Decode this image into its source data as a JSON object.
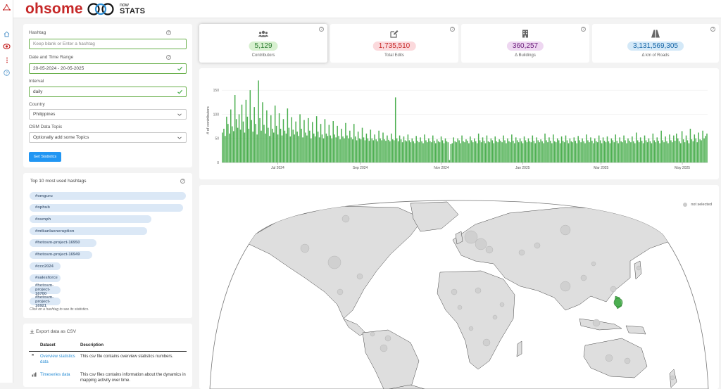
{
  "header": {
    "logo_text": "ohsome",
    "logo_now": "now",
    "logo_stats": "STATS"
  },
  "form": {
    "hashtag_label": "Hashtag",
    "hashtag_placeholder": "Keep blank or Enter a hashtag",
    "date_label": "Date and Time Range",
    "date_value": "20-05-2024 - 20-05-2025",
    "interval_label": "Interval",
    "interval_value": "daily",
    "country_label": "Country",
    "country_value": "Philippines",
    "topic_label": "OSM Data Topic",
    "topic_placeholder": "Optionally add some Topics",
    "submit_label": "Get Statistics"
  },
  "hashtags": {
    "title": "Top 10 most used hashtags",
    "items": [
      {
        "label": "#omguru",
        "share": 1.0
      },
      {
        "label": "#ophub",
        "share": 0.98
      },
      {
        "label": "#osmph",
        "share": 0.78
      },
      {
        "label": "#mtkanlaoneruption",
        "share": 0.75
      },
      {
        "label": "#hotosm-project-16950",
        "share": 0.43
      },
      {
        "label": "#hotosm-project-16949",
        "share": 0.4
      },
      {
        "label": "#ccc2024",
        "share": 0.2
      },
      {
        "label": "#salesforce",
        "share": 0.19
      },
      {
        "label": "#hotosm-project-16700",
        "share": 0.14
      },
      {
        "label": "#hotosm-project-16921",
        "share": 0.1
      }
    ],
    "note": "Click on a hashtag to see its statistics."
  },
  "export": {
    "title": "Export data as CSV",
    "col_dataset": "Dataset",
    "col_description": "Description",
    "rows": [
      {
        "icon": "quote-icon",
        "link": "Overview statistics data",
        "desc": "This csv file contains overview statistics numbers."
      },
      {
        "icon": "bar-chart-icon",
        "link": "Timeseries data",
        "desc": "This csv files contains information about the dynamics in mapping activity over time."
      }
    ]
  },
  "stats": [
    {
      "icon": "users-icon",
      "value": "5,129",
      "label": "Contributors",
      "bg": "#d7f0cf",
      "fg": "#2e7d32"
    },
    {
      "icon": "edit-icon",
      "value": "1,735,510",
      "label": "Total Edits",
      "bg": "#fbd9dc",
      "fg": "#c62828"
    },
    {
      "icon": "building-icon",
      "value": "360,257",
      "label": "Δ Buildings",
      "bg": "#eed7f1",
      "fg": "#6a1b7a"
    },
    {
      "icon": "road-icon",
      "value": "3,131,569,305",
      "label": "Δ km of Roads",
      "bg": "#d4e9f8",
      "fg": "#1565a6"
    }
  ],
  "chart_data": {
    "type": "bar",
    "ylabel": "# of contributors",
    "ylim": [
      0,
      175
    ],
    "yticks": [
      0,
      50,
      100,
      150
    ],
    "x_start": "2024-05-20",
    "x_end": "2025-05-20",
    "xticks": [
      {
        "label": "Jul 2024",
        "date": "2024-07-01"
      },
      {
        "label": "Sep 2024",
        "date": "2024-09-01"
      },
      {
        "label": "Nov 2024",
        "date": "2024-11-01"
      },
      {
        "label": "Jan 2025",
        "date": "2025-01-01"
      },
      {
        "label": "Mar 2025",
        "date": "2025-03-01"
      },
      {
        "label": "May 2025",
        "date": "2025-05-01"
      }
    ],
    "color": "#4caf50",
    "values": [
      62,
      70,
      55,
      95,
      80,
      60,
      110,
      75,
      65,
      140,
      90,
      72,
      100,
      68,
      120,
      85,
      62,
      130,
      95,
      70,
      150,
      88,
      64,
      115,
      80,
      58,
      170,
      92,
      66,
      125,
      78,
      60,
      108,
      72,
      55,
      98,
      70,
      62,
      118,
      76,
      58,
      102,
      70,
      56,
      90,
      66,
      60,
      112,
      72,
      54,
      94,
      68,
      58,
      85,
      64,
      55,
      100,
      70,
      52,
      88,
      62,
      56,
      92,
      66,
      50,
      84,
      60,
      54,
      96,
      64,
      52,
      80,
      58,
      50,
      90,
      60,
      55,
      78,
      56,
      50,
      86,
      58,
      52,
      76,
      55,
      48,
      70,
      54,
      50,
      82,
      56,
      50,
      66,
      52,
      48,
      80,
      54,
      46,
      64,
      50,
      48,
      72,
      52,
      46,
      60,
      50,
      45,
      68,
      50,
      46,
      58,
      48,
      44,
      66,
      50,
      46,
      62,
      48,
      45,
      56,
      47,
      44,
      60,
      48,
      46,
      135,
      50,
      44,
      56,
      48,
      42,
      54,
      46,
      44,
      58,
      46,
      42,
      50,
      44,
      40,
      55,
      45,
      42,
      52,
      44,
      40,
      58,
      46,
      42,
      50,
      44,
      42,
      56,
      45,
      40,
      48,
      44,
      42,
      54,
      46,
      40,
      50,
      44,
      42,
      5,
      38,
      40,
      52,
      44,
      42,
      50,
      46,
      40,
      56,
      44,
      42,
      48,
      45,
      40,
      54,
      46,
      42,
      50,
      44,
      40,
      60,
      46,
      42,
      52,
      45,
      40,
      56,
      44,
      42,
      50,
      46,
      40,
      54,
      44,
      42,
      48,
      45,
      42,
      56,
      46,
      40,
      50,
      44,
      42,
      58,
      45,
      40,
      52,
      46,
      42,
      50,
      44,
      40,
      54,
      46,
      42,
      50,
      44,
      42,
      56,
      45,
      40,
      52,
      46,
      42,
      48,
      44,
      40,
      60,
      46,
      42,
      52,
      45,
      40,
      58,
      44,
      42,
      50,
      46,
      40,
      54,
      45,
      42,
      56,
      46,
      40,
      50,
      44,
      42,
      52,
      45,
      40,
      55,
      46,
      42,
      50,
      44,
      40,
      58,
      46,
      42,
      52,
      45,
      40,
      50,
      44,
      42,
      56,
      46,
      40,
      52,
      45,
      42,
      54,
      44,
      40,
      50,
      46,
      42,
      58,
      45,
      40,
      52,
      44,
      42,
      56,
      46,
      40,
      50,
      45,
      42,
      54,
      44,
      40,
      62,
      46,
      42,
      52,
      45,
      40,
      56,
      46,
      42,
      50,
      44,
      40,
      60,
      46,
      42,
      52,
      45,
      40,
      66,
      46,
      42,
      54,
      44,
      40,
      58,
      46,
      42,
      56,
      45,
      60,
      50,
      44,
      40,
      65,
      48,
      42,
      56,
      46,
      40,
      70,
      48,
      44,
      58,
      50,
      42,
      62,
      48,
      46,
      66,
      50,
      55,
      60
    ]
  },
  "map": {
    "legend_label": "not selected",
    "selected_country": "Philippines",
    "selected_color": "#4caf50"
  }
}
